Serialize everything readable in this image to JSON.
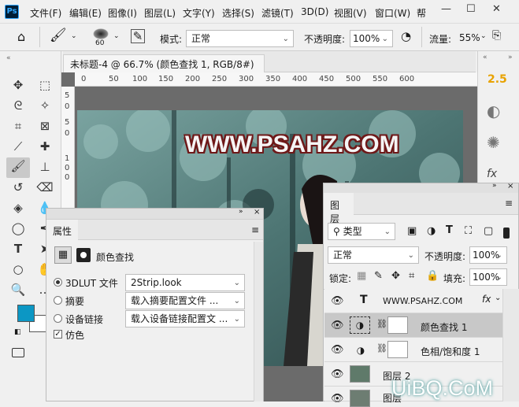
{
  "menubar": {
    "logo": "Ps",
    "items": [
      "文件(F)",
      "编辑(E)",
      "图像(I)",
      "图层(L)",
      "文字(Y)",
      "选择(S)",
      "滤镜(T)",
      "3D(D)",
      "视图(V)",
      "窗口(W)",
      "帮"
    ],
    "minimize": "—",
    "maximize": "☐",
    "close": "✕"
  },
  "options": {
    "brush_size": "60",
    "mode_label": "模式:",
    "mode_value": "正常",
    "opacity_label": "不透明度:",
    "opacity_value": "100%",
    "flow_label": "流量:",
    "flow_value": "55%"
  },
  "document": {
    "tab_title": "未标题-4 @ 66.7% (颜色查找 1, RGB/8#) *",
    "tab_close": "×",
    "ruler_h": [
      "0",
      "50",
      "100",
      "150",
      "200",
      "250",
      "300",
      "350",
      "400",
      "450",
      "500",
      "550",
      "600"
    ],
    "ruler_v": [
      "5",
      "0",
      "5",
      "0",
      "1",
      "0",
      "0"
    ],
    "watermark": "WWW.PSAHZ.COM"
  },
  "rightstrip": {
    "version": "2.5",
    "fx": "fx"
  },
  "properties": {
    "title": "属性",
    "subtitle": "颜色查找",
    "rows": [
      {
        "label": "3DLUT 文件",
        "value": "2Strip.look",
        "selected": true
      },
      {
        "label": "摘要",
        "value": "载入摘要配置文件 ...",
        "selected": false
      },
      {
        "label": "设备链接",
        "value": "载入设备链接配置文 ...",
        "selected": false
      }
    ],
    "dither_label": "仿色",
    "dither_checked": "✓"
  },
  "layers": {
    "title": "图层",
    "kind_label": "类型",
    "blend_mode": "正常",
    "opacity_label": "不透明度:",
    "opacity_value": "100%",
    "lock_label": "锁定:",
    "fill_label": "填充:",
    "fill_value": "100%",
    "rows": [
      {
        "name": "WWW.PSAHZ.COM",
        "kind": "text",
        "fx": "fx"
      },
      {
        "name": "颜色查找 1",
        "kind": "adjustment"
      },
      {
        "name": "色相/饱和度 1",
        "kind": "adjustment"
      },
      {
        "name": "图层 2",
        "kind": "pixel"
      },
      {
        "name": "图层",
        "kind": "pixel"
      }
    ]
  },
  "colors": {
    "foreground": "#0c97c4",
    "background": "#ffffff"
  },
  "site_watermark": "UiBQ.CoM"
}
